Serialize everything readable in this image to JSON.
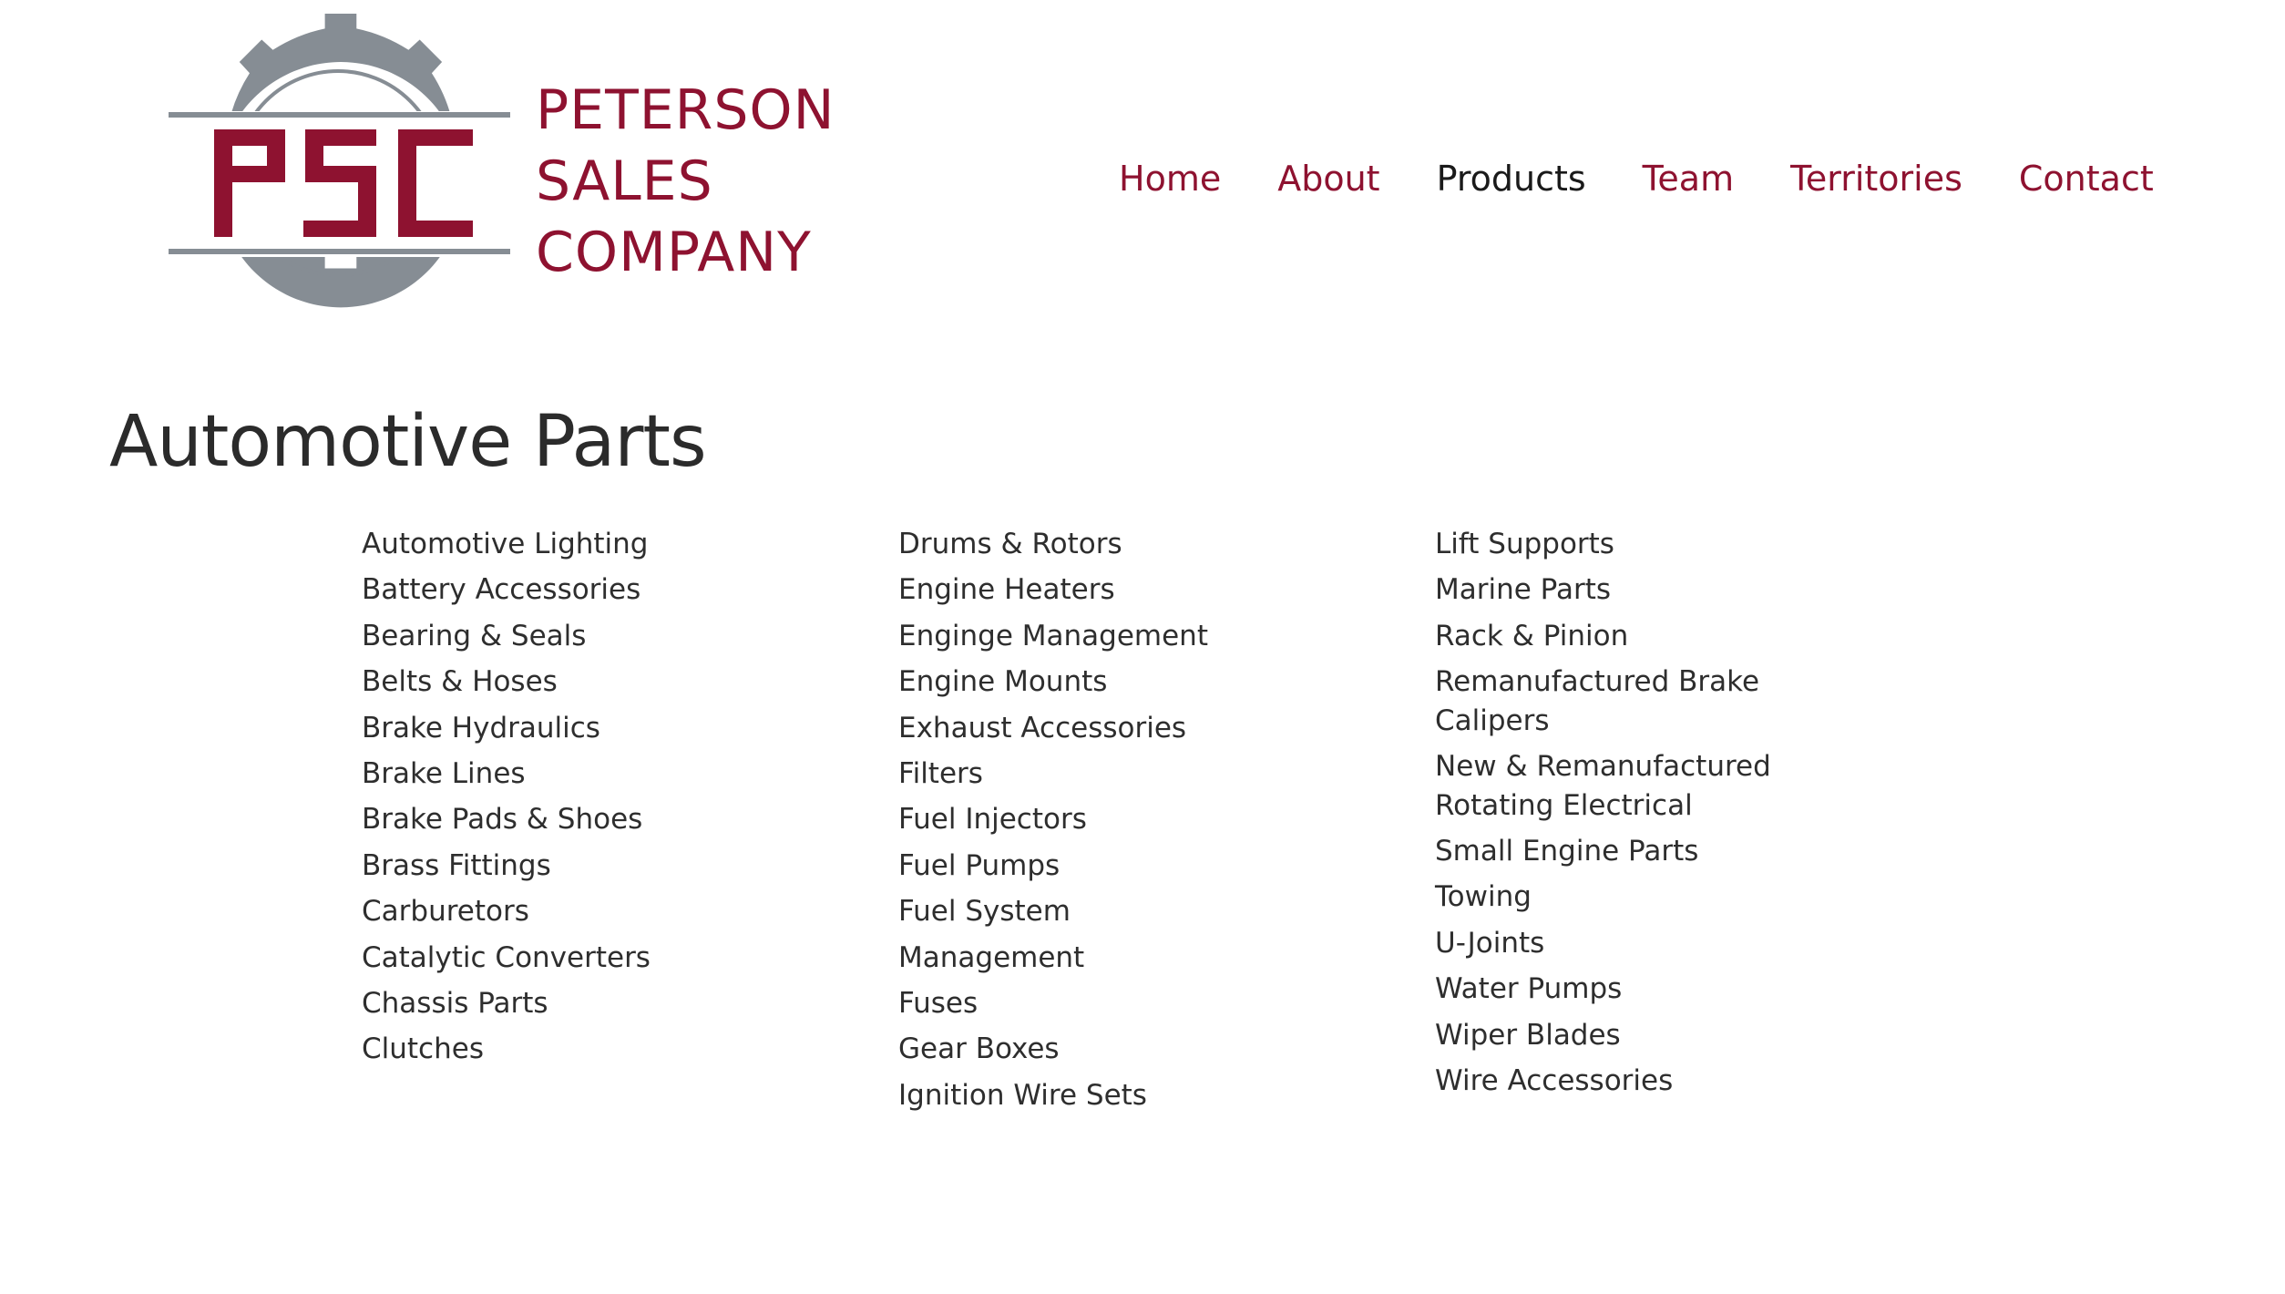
{
  "brand": {
    "logo_letters": "PSC",
    "name_lines": [
      "PETERSON",
      "SALES",
      "COMPANY"
    ],
    "colors": {
      "maroon": "#8e1230",
      "gear_gray": "#868d94",
      "text": "#2b2b2b"
    }
  },
  "nav": {
    "items": [
      {
        "label": "Home",
        "active": false
      },
      {
        "label": "About",
        "active": false
      },
      {
        "label": "Products",
        "active": true
      },
      {
        "label": "Team",
        "active": false
      },
      {
        "label": "Territories",
        "active": false
      },
      {
        "label": "Contact",
        "active": false
      }
    ]
  },
  "main": {
    "title": "Automotive Parts",
    "columns": [
      [
        "Automotive Lighting",
        "Battery Accessories",
        "Bearing & Seals",
        "Belts & Hoses",
        "Brake Hydraulics",
        "Brake Lines",
        "Brake Pads & Shoes",
        "Brass Fittings",
        "Carburetors",
        "Catalytic Converters",
        "Chassis Parts",
        "Clutches"
      ],
      [
        "Drums & Rotors",
        "Engine Heaters",
        "Enginge Management",
        "Engine Mounts",
        "Exhaust Accessories",
        "Filters",
        "Fuel Injectors",
        "Fuel Pumps",
        "Fuel System",
        "Management",
        "Fuses",
        "Gear Boxes",
        "Ignition Wire Sets"
      ],
      [
        "Lift Supports",
        "Marine Parts",
        "Rack & Pinion",
        "Remanufactured Brake Calipers",
        "New & Remanufactured Rotating Electrical",
        "Small Engine Parts",
        "Towing",
        "U-Joints",
        "Water Pumps",
        "Wiper Blades",
        "Wire Accessories"
      ]
    ]
  }
}
